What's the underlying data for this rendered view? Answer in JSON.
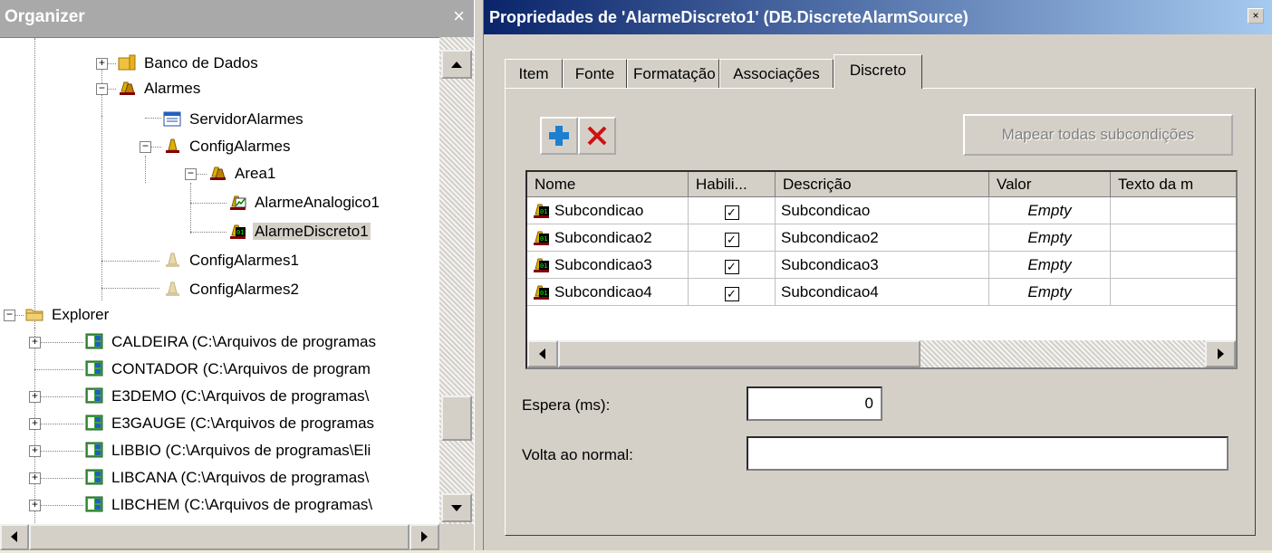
{
  "organizer": {
    "title": "Organizer",
    "close": "×",
    "tree": [
      {
        "label": "Banco de Dados",
        "icon": "folder-db-icon"
      },
      {
        "label": "Alarmes",
        "icon": "alarm-folder-icon"
      },
      {
        "label": "ServidorAlarmes",
        "icon": "alarm-server-icon"
      },
      {
        "label": "ConfigAlarmes",
        "icon": "alarm-config-icon"
      },
      {
        "label": "Area1",
        "icon": "alarm-area-icon"
      },
      {
        "label": "AlarmeAnalogico1",
        "icon": "analog-alarm-icon"
      },
      {
        "label": "AlarmeDiscreto1",
        "icon": "discrete-alarm-icon"
      },
      {
        "label": "ConfigAlarmes1",
        "icon": "alarm-config-disabled-icon"
      },
      {
        "label": "ConfigAlarmes2",
        "icon": "alarm-config-disabled-icon"
      },
      {
        "label": "Explorer",
        "icon": "folder-icon"
      },
      {
        "label": "CALDEIRA (C:\\Arquivos de programas",
        "icon": "library-icon"
      },
      {
        "label": "CONTADOR (C:\\Arquivos de program",
        "icon": "library-icon"
      },
      {
        "label": "E3DEMO (C:\\Arquivos de programas\\",
        "icon": "library-icon"
      },
      {
        "label": "E3GAUGE (C:\\Arquivos de programas",
        "icon": "library-icon"
      },
      {
        "label": "LIBBIO (C:\\Arquivos de programas\\Eli",
        "icon": "library-icon"
      },
      {
        "label": "LIBCANA (C:\\Arquivos de programas\\",
        "icon": "library-icon"
      },
      {
        "label": "LIBCHEM (C:\\Arquivos de programas\\",
        "icon": "library-icon"
      }
    ]
  },
  "props": {
    "title": "Propriedades de 'AlarmeDiscreto1' (DB.DiscreteAlarmSource)",
    "close": "×",
    "tabs": [
      "Item",
      "Fonte",
      "Formatação",
      "Associações",
      "Discreto"
    ],
    "map_button": "Mapear todas subcondições",
    "grid": {
      "headers": [
        "Nome",
        "Habili...",
        "Descrição",
        "Valor",
        "Texto da m"
      ],
      "rows": [
        {
          "nome": "Subcondicao",
          "habilitado": "✓",
          "descricao": "Subcondicao",
          "valor": "Empty",
          "texto": ""
        },
        {
          "nome": "Subcondicao2",
          "habilitado": "✓",
          "descricao": "Subcondicao2",
          "valor": "Empty",
          "texto": ""
        },
        {
          "nome": "Subcondicao3",
          "habilitado": "✓",
          "descricao": "Subcondicao3",
          "valor": "Empty",
          "texto": ""
        },
        {
          "nome": "Subcondicao4",
          "habilitado": "✓",
          "descricao": "Subcondicao4",
          "valor": "Empty",
          "texto": ""
        }
      ]
    },
    "espera_label": "Espera (ms):",
    "espera_value": "0",
    "volta_label": "Volta ao normal:",
    "volta_value": ""
  }
}
